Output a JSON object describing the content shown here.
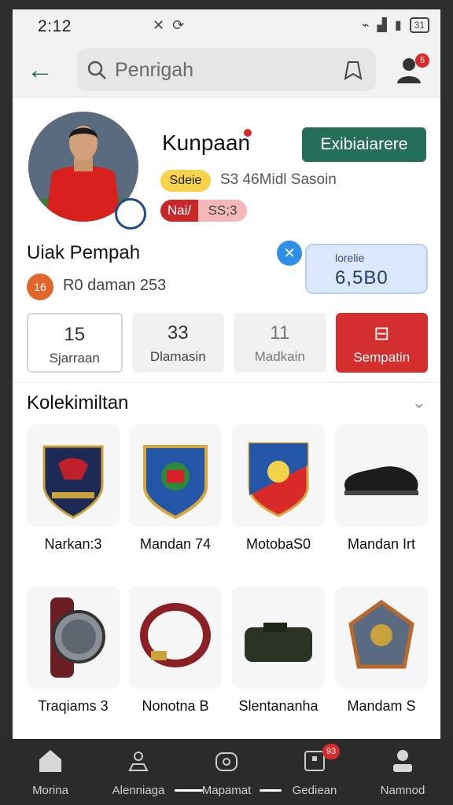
{
  "status": {
    "time": "2:12",
    "battery": "31"
  },
  "search": {
    "placeholder": "Penrigah"
  },
  "profile": {
    "name": "Kunpaan",
    "action_label": "Exibiaiarere",
    "tag_yellow": "Sdeie",
    "season": "S3 46Midl Sasoin",
    "tag_red_left": "Nai/",
    "tag_red_right": "SS;3",
    "notifications": "5"
  },
  "info": {
    "title": "Uiak Pempah",
    "coin": "16",
    "subtitle": "R0 daman 253",
    "price_label": "lorelie",
    "price_value": "6,5B0"
  },
  "stats": [
    {
      "value": "15",
      "label": "Sjarraan"
    },
    {
      "value": "33",
      "label": "Dlamasin"
    },
    {
      "value": "11",
      "label": "Madkain"
    },
    {
      "value": "",
      "label": "Sempatin"
    }
  ],
  "collection": {
    "title": "Kolekimiltan",
    "items": [
      {
        "label": "Narkan:3",
        "icon": "crest-eagle-icon"
      },
      {
        "label": "Mandan 74",
        "icon": "crest-blue-icon"
      },
      {
        "label": "MotobaS0",
        "icon": "crest-shield-icon"
      },
      {
        "label": "Mandan Irt",
        "icon": "shoe-icon"
      },
      {
        "label": "Traqiams 3",
        "icon": "watch-icon"
      },
      {
        "label": "Nonotna B",
        "icon": "bracelet-icon"
      },
      {
        "label": "Slentananha",
        "icon": "bag-icon"
      },
      {
        "label": "Mandam S",
        "icon": "badge-icon"
      }
    ]
  },
  "nav": [
    {
      "label": "Morina",
      "icon": "home-icon"
    },
    {
      "label": "Alenniaga",
      "icon": "alert-icon"
    },
    {
      "label": "Mapamat",
      "icon": "camera-icon"
    },
    {
      "label": "Gediean",
      "icon": "inbox-icon",
      "badge": "93"
    },
    {
      "label": "Namnod",
      "icon": "profile-icon"
    }
  ],
  "colors": {
    "accent": "#256f5a",
    "danger": "#d32f2f",
    "price": "#dbe8fb"
  }
}
